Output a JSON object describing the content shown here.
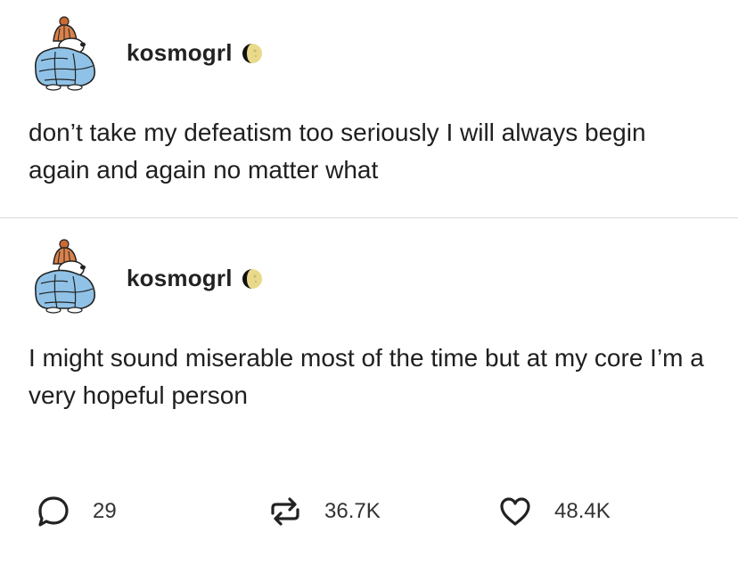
{
  "posts": [
    {
      "username": "kosmogrl",
      "avatar_icon": "snoopy-winter-hat-avatar-icon",
      "badge_icon": "moon-phase-icon",
      "text": "don’t take my defeatism too seriously I will always begin again and again no matter what"
    },
    {
      "username": "kosmogrl",
      "avatar_icon": "snoopy-winter-hat-avatar-icon",
      "badge_icon": "moon-phase-icon",
      "text": "I might sound miserable most of the time but at my core I’m a very hopeful person"
    }
  ],
  "actions": {
    "replies": {
      "icon": "speech-bubble-icon",
      "count": "29"
    },
    "reblogs": {
      "icon": "reblog-arrows-icon",
      "count": "36.7K"
    },
    "likes": {
      "icon": "heart-icon",
      "count": "48.4K"
    }
  },
  "colors": {
    "text": "#1f1f1f",
    "divider": "#d9d9d9",
    "coat_blue": "#8fc2e6",
    "hat_orange": "#d9824a"
  }
}
